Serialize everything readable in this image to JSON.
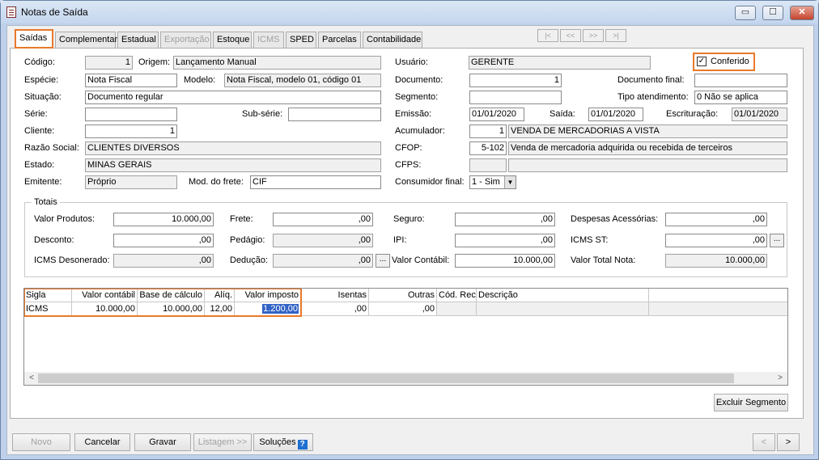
{
  "window": {
    "title": "Notas de Saída",
    "min": "▭",
    "max": "☐",
    "close": "✕"
  },
  "tabs": [
    {
      "label": "Saídas"
    },
    {
      "label": "Complementar"
    },
    {
      "label": "Estadual"
    },
    {
      "label": "Exportação"
    },
    {
      "label": "Estoque"
    },
    {
      "label": "ICMS"
    },
    {
      "label": "SPED"
    },
    {
      "label": "Parcelas"
    },
    {
      "label": "Contabilidade"
    }
  ],
  "record_nav": {
    "first": "|<",
    "prev": "<<",
    "next": ">>",
    "last": ">|"
  },
  "form": {
    "codigo_label": "Código:",
    "codigo": "1",
    "origem_label": "Origem:",
    "origem": "Lançamento Manual",
    "usuario_label": "Usuário:",
    "usuario": "GERENTE",
    "conferido_label": "Conferido",
    "conferido_mark": "✓",
    "especie_label": "Espécie:",
    "especie": "Nota Fiscal",
    "modelo_label": "Modelo:",
    "modelo": "Nota Fiscal, modelo 01, código 01",
    "documento_label": "Documento:",
    "documento": "1",
    "documento_final_label": "Documento final:",
    "documento_final": "",
    "situacao_label": "Situação:",
    "situacao": "Documento regular",
    "segmento_label": "Segmento:",
    "segmento": "",
    "tipo_atendimento_label": "Tipo atendimento:",
    "tipo_atendimento": "0 Não se aplica",
    "serie_label": "Série:",
    "serie": "",
    "subserie_label": "Sub-série:",
    "subserie": "",
    "emissao_label": "Emissão:",
    "emissao": "01/01/2020",
    "saida_label": "Saída:",
    "saida": "01/01/2020",
    "escrituracao_label": "Escrituração:",
    "escrituracao": "01/01/2020",
    "cliente_label": "Cliente:",
    "cliente": "1",
    "acumulador_label": "Acumulador:",
    "acumulador": "1",
    "acumulador_desc": "VENDA DE MERCADORIAS A VISTA",
    "razao_label": "Razão Social:",
    "razao": "CLIENTES DIVERSOS",
    "cfop_label": "CFOP:",
    "cfop": "5-102",
    "cfop_desc": "Venda de mercadoria adquirida ou recebida de terceiros",
    "estado_label": "Estado:",
    "estado": "MINAS GERAIS",
    "cfps_label": "CFPS:",
    "cfps": "",
    "cfps_desc": "",
    "emitente_label": "Emitente:",
    "emitente": "Próprio",
    "frete_label": "Mod. do frete:",
    "frete": "CIF",
    "consumidor_label": "Consumidor final:",
    "consumidor": "1 - Sim"
  },
  "totais": {
    "label": "Totais",
    "valor_produtos_label": "Valor Produtos:",
    "valor_produtos": "10.000,00",
    "frete_label": "Frete:",
    "frete": ",00",
    "seguro_label": "Seguro:",
    "seguro": ",00",
    "despesas_label": "Despesas Acessórias:",
    "despesas": ",00",
    "desconto_label": "Desconto:",
    "desconto": ",00",
    "pedagio_label": "Pedágio:",
    "pedagio": ",00",
    "ipi_label": "IPI:",
    "ipi": ",00",
    "icms_st_label": "ICMS ST:",
    "icms_st": ",00",
    "icms_deson_label": "ICMS Desonerado:",
    "icms_deson": ",00",
    "deducao_label": "Dedução:",
    "deducao": ",00",
    "valor_contabil_label": "Valor Contábil:",
    "valor_contabil": "10.000,00",
    "valor_total_label": "Valor Total Nota:",
    "valor_total": "10.000,00",
    "ellipsis": "..."
  },
  "grid": {
    "headers": [
      "Sigla",
      "Valor contábil",
      "Base de cálculo",
      "Alíq.",
      "Valor imposto",
      "Isentas",
      "Outras",
      "Cód. Rec.",
      "Descrição"
    ],
    "rows": [
      [
        "ICMS",
        "10.000,00",
        "10.000,00",
        "12,00",
        "1.200,00",
        ",00",
        ",00",
        "",
        ""
      ]
    ]
  },
  "buttons": {
    "excluir_segmento": "Excluir Segmento",
    "novo": "Novo",
    "cancelar": "Cancelar",
    "gravar": "Gravar",
    "listagem": "Listagem >>",
    "solucoes": "Soluções",
    "help": "?",
    "prev": "<",
    "next": ">"
  },
  "scroll": {
    "left": "<",
    "right": ">"
  }
}
